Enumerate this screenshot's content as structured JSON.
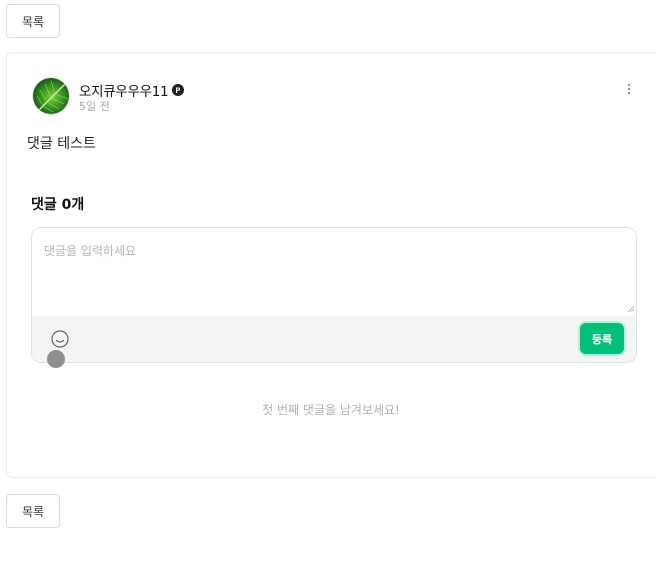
{
  "nav": {
    "list_label": "목록"
  },
  "post": {
    "author": "오지큐우우우11",
    "time": "5일 전",
    "body": "댓글 테스트"
  },
  "comments": {
    "heading": "댓글 0개",
    "input_placeholder": "댓글을 입력하세요",
    "submit_label": "등록",
    "empty_message": "첫 번째 댓글을 남겨보세요!"
  },
  "icons": {
    "badge": "premium-badge-icon",
    "more": "more-vertical-icon",
    "emoji": "smile-icon"
  },
  "colors": {
    "accent": "#00c07a",
    "toolbar_bg": "#f4f6f5",
    "muted_text": "#a8a8a8"
  }
}
